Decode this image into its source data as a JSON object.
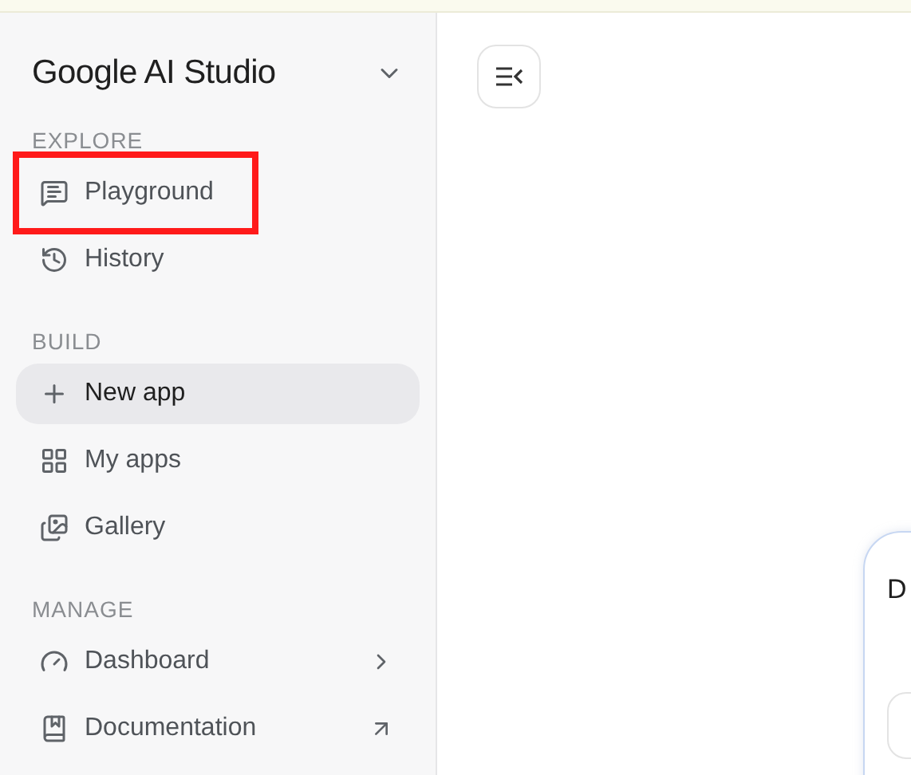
{
  "sidebar": {
    "brand": "Google AI Studio",
    "sections": [
      {
        "title": "EXPLORE",
        "items": [
          {
            "label": "Playground",
            "kind": "plain",
            "selected": false,
            "highlighted": true
          },
          {
            "label": "History",
            "kind": "plain",
            "selected": false,
            "highlighted": false
          }
        ]
      },
      {
        "title": "BUILD",
        "items": [
          {
            "label": "New app",
            "kind": "plain",
            "selected": true,
            "highlighted": false
          },
          {
            "label": "My apps",
            "kind": "plain",
            "selected": false,
            "highlighted": false
          },
          {
            "label": "Gallery",
            "kind": "plain",
            "selected": false,
            "highlighted": false
          }
        ]
      },
      {
        "title": "MANAGE",
        "items": [
          {
            "label": "Dashboard",
            "kind": "submenu",
            "selected": false,
            "highlighted": false
          },
          {
            "label": "Documentation",
            "kind": "external",
            "selected": false,
            "highlighted": false
          }
        ]
      }
    ]
  },
  "main": {
    "card": {
      "heading": "D"
    }
  }
}
